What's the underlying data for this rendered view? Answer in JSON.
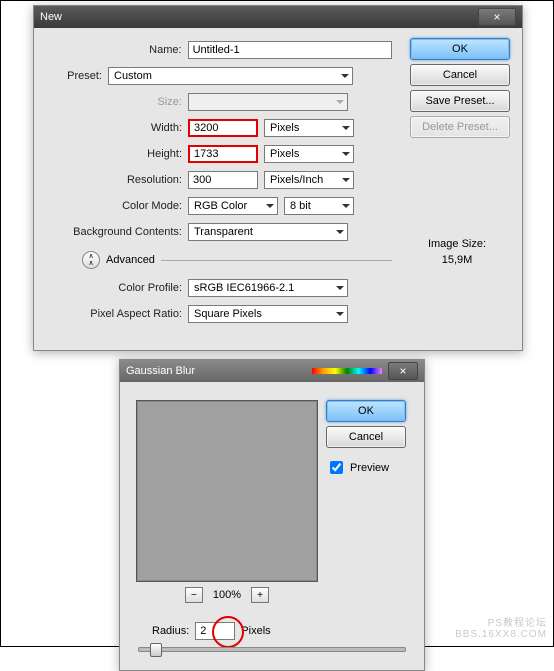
{
  "newDialog": {
    "title": "New",
    "labels": {
      "name": "Name:",
      "preset": "Preset:",
      "size": "Size:",
      "width": "Width:",
      "height": "Height:",
      "resolution": "Resolution:",
      "colorMode": "Color Mode:",
      "bgContents": "Background Contents:",
      "advanced": "Advanced",
      "colorProfile": "Color Profile:",
      "pixelAspect": "Pixel Aspect Ratio:"
    },
    "values": {
      "name": "Untitled-1",
      "preset": "Custom",
      "size": "",
      "width": "3200",
      "widthUnit": "Pixels",
      "height": "1733",
      "heightUnit": "Pixels",
      "resolution": "300",
      "resolutionUnit": "Pixels/Inch",
      "colorMode": "RGB Color",
      "colorDepth": "8 bit",
      "bgContents": "Transparent",
      "colorProfile": "sRGB IEC61966-2.1",
      "pixelAspect": "Square Pixels"
    },
    "buttons": {
      "ok": "OK",
      "cancel": "Cancel",
      "savePreset": "Save Preset...",
      "deletePreset": "Delete Preset..."
    },
    "imageSize": {
      "label": "Image Size:",
      "value": "15,9M"
    }
  },
  "gaussianBlur": {
    "title": "Gaussian Blur",
    "buttons": {
      "ok": "OK",
      "cancel": "Cancel"
    },
    "preview": "Preview",
    "zoom": "100%",
    "radiusLabel": "Radius:",
    "radiusValue": "2",
    "radiusUnit": "Pixels"
  },
  "watermark": {
    "line1": "PS教程论坛",
    "line2": "BBS.16XX8.COM"
  }
}
